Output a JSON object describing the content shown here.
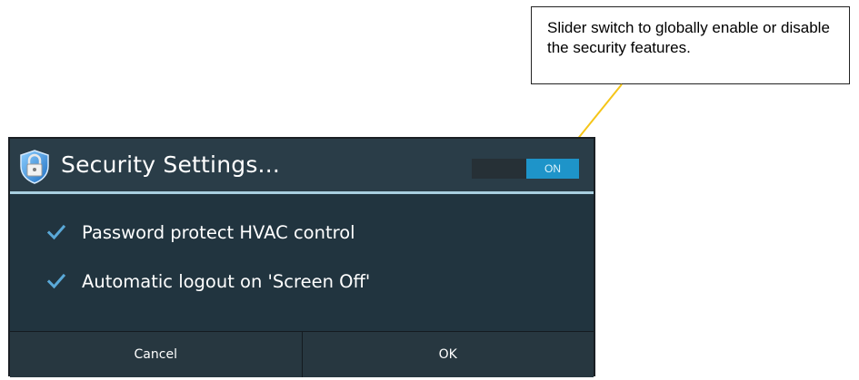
{
  "callout": {
    "text": "Slider switch to globally enable or disable the security features."
  },
  "dialog": {
    "title": "Security Settings...",
    "icon": "shield-lock-icon",
    "toggle": {
      "state_label": "ON",
      "enabled": true,
      "accent_color": "#1e94c9"
    },
    "options": [
      {
        "label": "Password protect HVAC control",
        "checked": true
      },
      {
        "label": "Automatic logout on 'Screen Off'",
        "checked": true
      }
    ],
    "buttons": {
      "cancel_label": "Cancel",
      "ok_label": "OK"
    }
  },
  "colors": {
    "dialog_background": "#21343f",
    "header_background": "#2a3d48",
    "divider": "#a8cfdf",
    "check_color": "#5aa9d8",
    "arrow_color": "#f5c518"
  }
}
